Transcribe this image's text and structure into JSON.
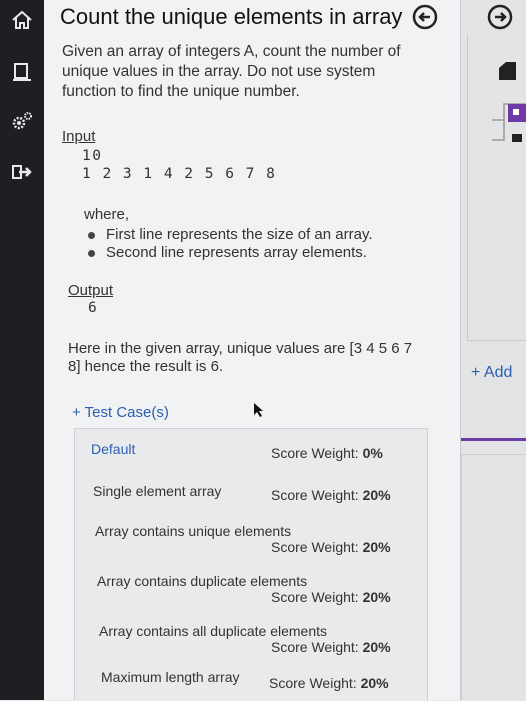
{
  "problem": {
    "title": "Count the unique elements in array",
    "description": "Given an array of integers A, count the number of unique values in the array. Do not use system function to find the unique number.",
    "input_label": "Input",
    "input_line1": "10",
    "input_line2": "1 2 3 1 4 2 5 6 7 8",
    "where_label": "where,",
    "bullets": [
      "First line represents the size of an array.",
      "Second line represents array elements."
    ],
    "output_label": "Output",
    "output_value": "6",
    "explanation": "Here in the given array, unique values are [3 4 5 6 7 8] hence the result is 6."
  },
  "test_cases": {
    "add_label": "+ Test Case(s)",
    "score_label": "Score Weight:",
    "items": [
      {
        "name": "Default",
        "weight": "0%"
      },
      {
        "name": "Single element array",
        "weight": "20%"
      },
      {
        "name": "Array contains unique elements",
        "weight": "20%"
      },
      {
        "name": "Array contains duplicate elements",
        "weight": "20%"
      },
      {
        "name": "Array contains all duplicate elements",
        "weight": "20%"
      },
      {
        "name": "Maximum length array",
        "weight": "20%"
      }
    ]
  },
  "right_panel": {
    "add_label": "+ Add"
  },
  "sidebar": {
    "icons": [
      "home-icon",
      "monitor-icon",
      "settings-gears-icon",
      "logout-icon"
    ]
  },
  "colors": {
    "sidebar_bg": "#1d1f23",
    "link_blue": "#2a5fb0",
    "accent_purple": "#6d3aa6"
  }
}
